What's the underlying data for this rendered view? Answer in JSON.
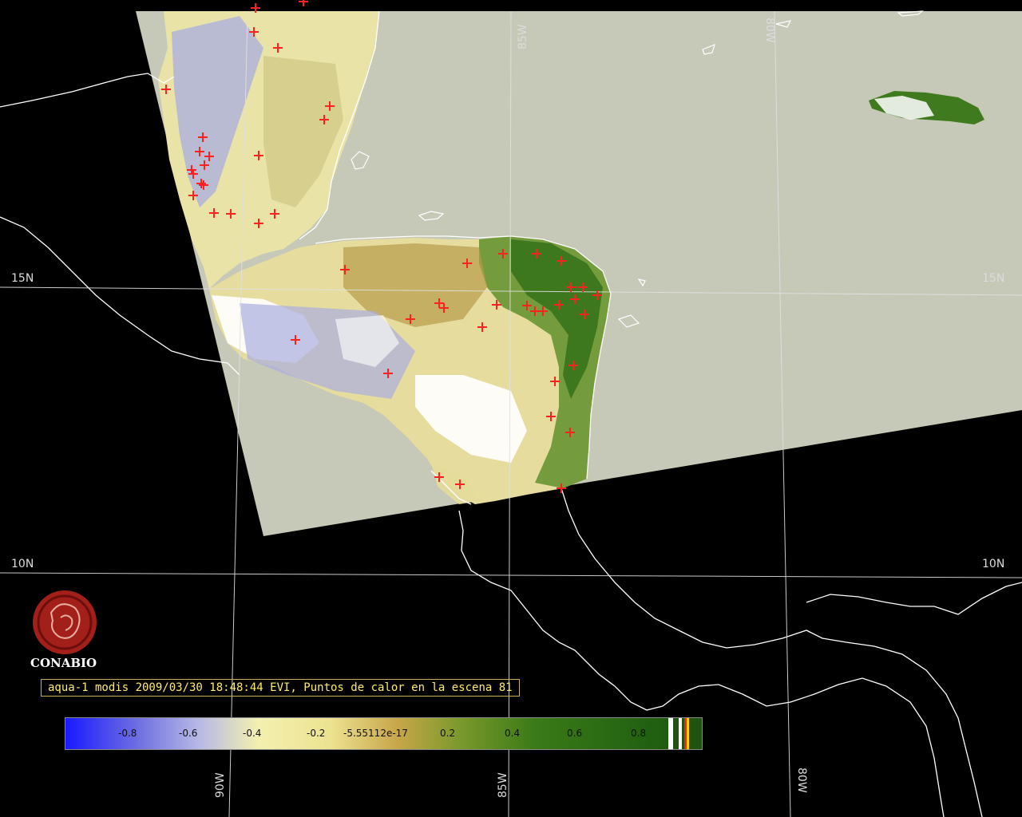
{
  "grid": {
    "lon_top": [
      "85W",
      "80W"
    ],
    "lon_bottom": [
      "90W",
      "85W",
      "80W"
    ],
    "lat_left": [
      "15N",
      "10N"
    ],
    "lat_right": [
      "15N",
      "10N"
    ]
  },
  "logo": {
    "text": "CONABIO",
    "icon": "conabio-seal-icon",
    "color": "#a3201a"
  },
  "caption": "aqua-1 modis 2009/03/30 18:48:44 EVI, Puntos de calor en la escena 81",
  "colorbar": {
    "ticks": [
      "-0.8",
      "-0.6",
      "-0.4",
      "-0.2",
      "-5.55112e-17",
      "0.2",
      "0.4",
      "0.6",
      "0.8"
    ],
    "colors": [
      "#1a1aff",
      "#b6b8e6",
      "#f3f0b0",
      "#c8a64a",
      "#3a7a18",
      "#1e5c10"
    ]
  },
  "colors": {
    "background": "#000000",
    "swath": "#c6c8b8",
    "hotspot": "#ff2020",
    "coastline": "#ffffff",
    "grid": "#e0e0e0"
  }
}
